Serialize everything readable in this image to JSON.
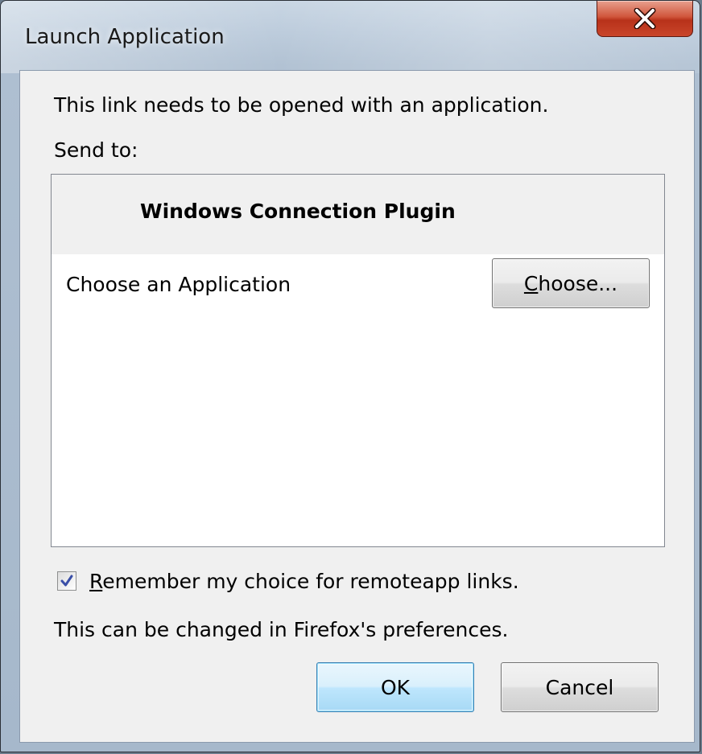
{
  "window": {
    "title": "Launch Application",
    "close_label": "X"
  },
  "dialog": {
    "message": "This link needs to be opened with an application.",
    "send_to_label": "Send to:",
    "list": {
      "header": "Windows Connection Plugin",
      "rows": [
        {
          "label": "Choose an Application",
          "button": {
            "mnemonic": "C",
            "rest": "hoose..."
          }
        }
      ]
    },
    "remember": {
      "checked": true,
      "mnemonic": "R",
      "rest": "emember my choice for remoteapp links."
    },
    "note": "This can be changed in Firefox's preferences.",
    "buttons": {
      "ok": "OK",
      "cancel": "Cancel"
    }
  }
}
